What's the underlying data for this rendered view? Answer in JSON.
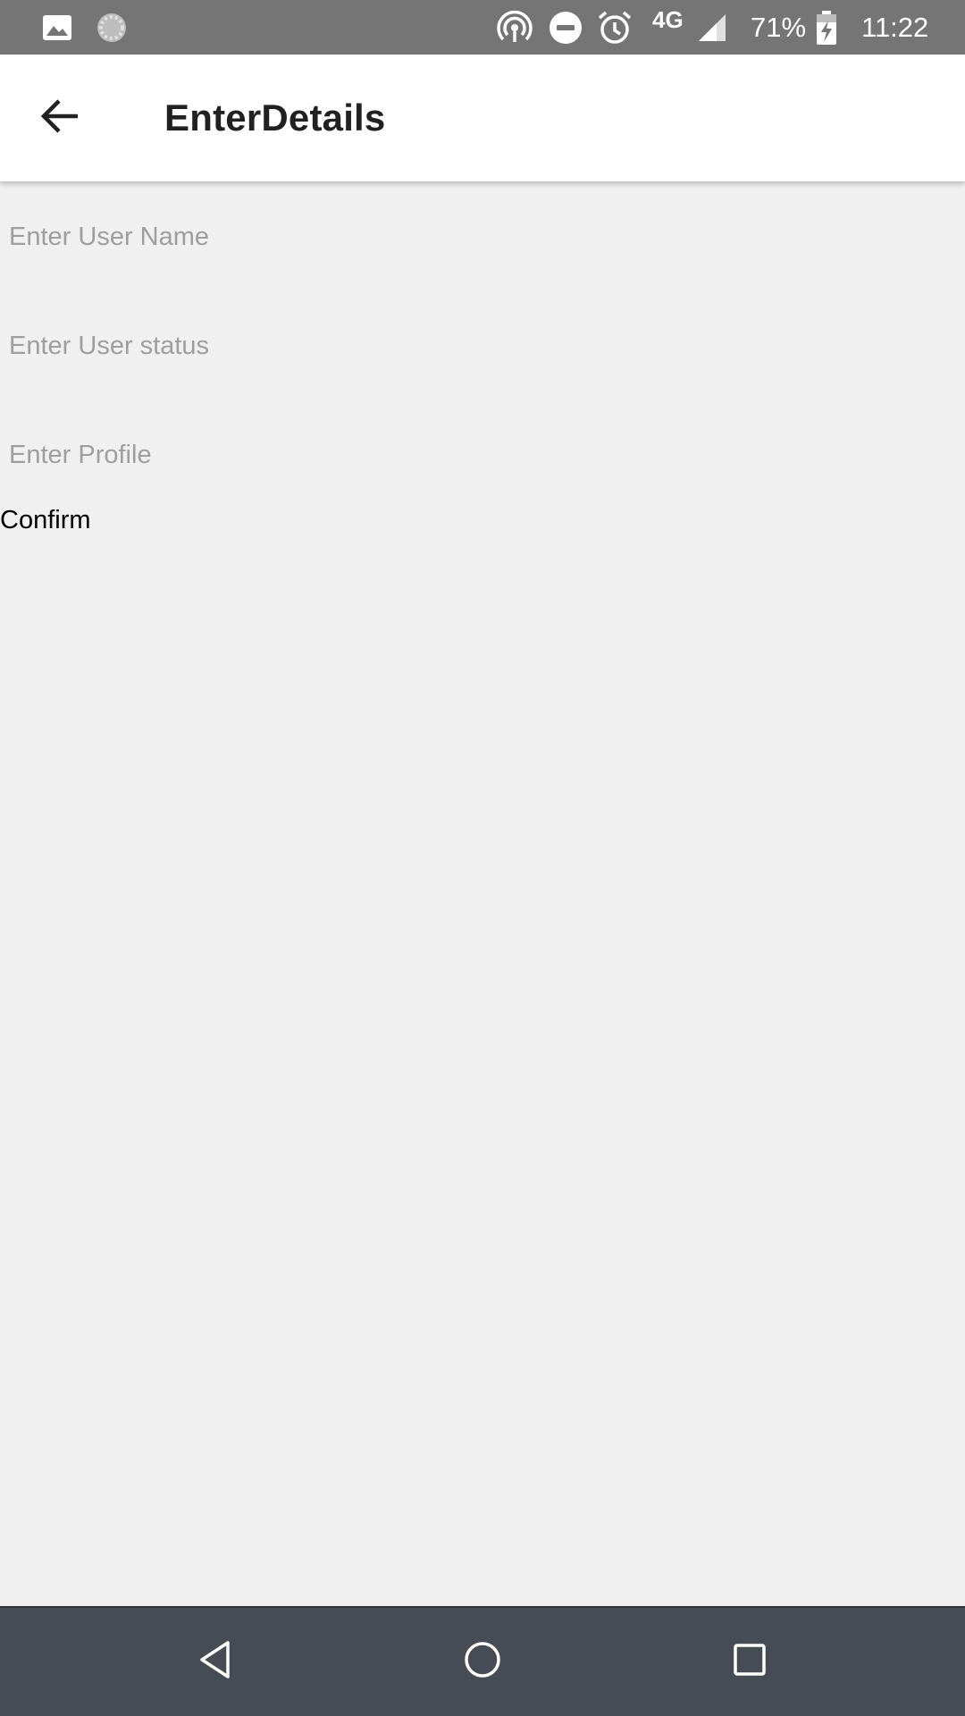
{
  "status_bar": {
    "icons": [
      "image-icon",
      "sync-icon",
      "hotspot-icon",
      "do-not-disturb-icon",
      "alarm-icon",
      "signal-icon",
      "battery-charging-icon"
    ],
    "network": "4G",
    "battery": "71%",
    "time": "11:22"
  },
  "app_bar": {
    "title": "EnterDetails",
    "back_icon": "arrow-back-icon"
  },
  "form": {
    "user_name": {
      "value": "",
      "placeholder": "Enter User Name"
    },
    "user_status": {
      "value": "",
      "placeholder": "Enter User status"
    },
    "profile": {
      "value": "",
      "placeholder": "Enter Profile"
    },
    "confirm_label": "Confirm"
  },
  "nav_bar": {
    "buttons": [
      "back-triangle-icon",
      "home-circle-icon",
      "recents-square-icon"
    ]
  },
  "colors": {
    "status_bar": "#757575",
    "app_bar": "#ffffff",
    "background": "#f0f0f0",
    "nav_bar": "#464c53",
    "placeholder": "#9e9e9e"
  }
}
